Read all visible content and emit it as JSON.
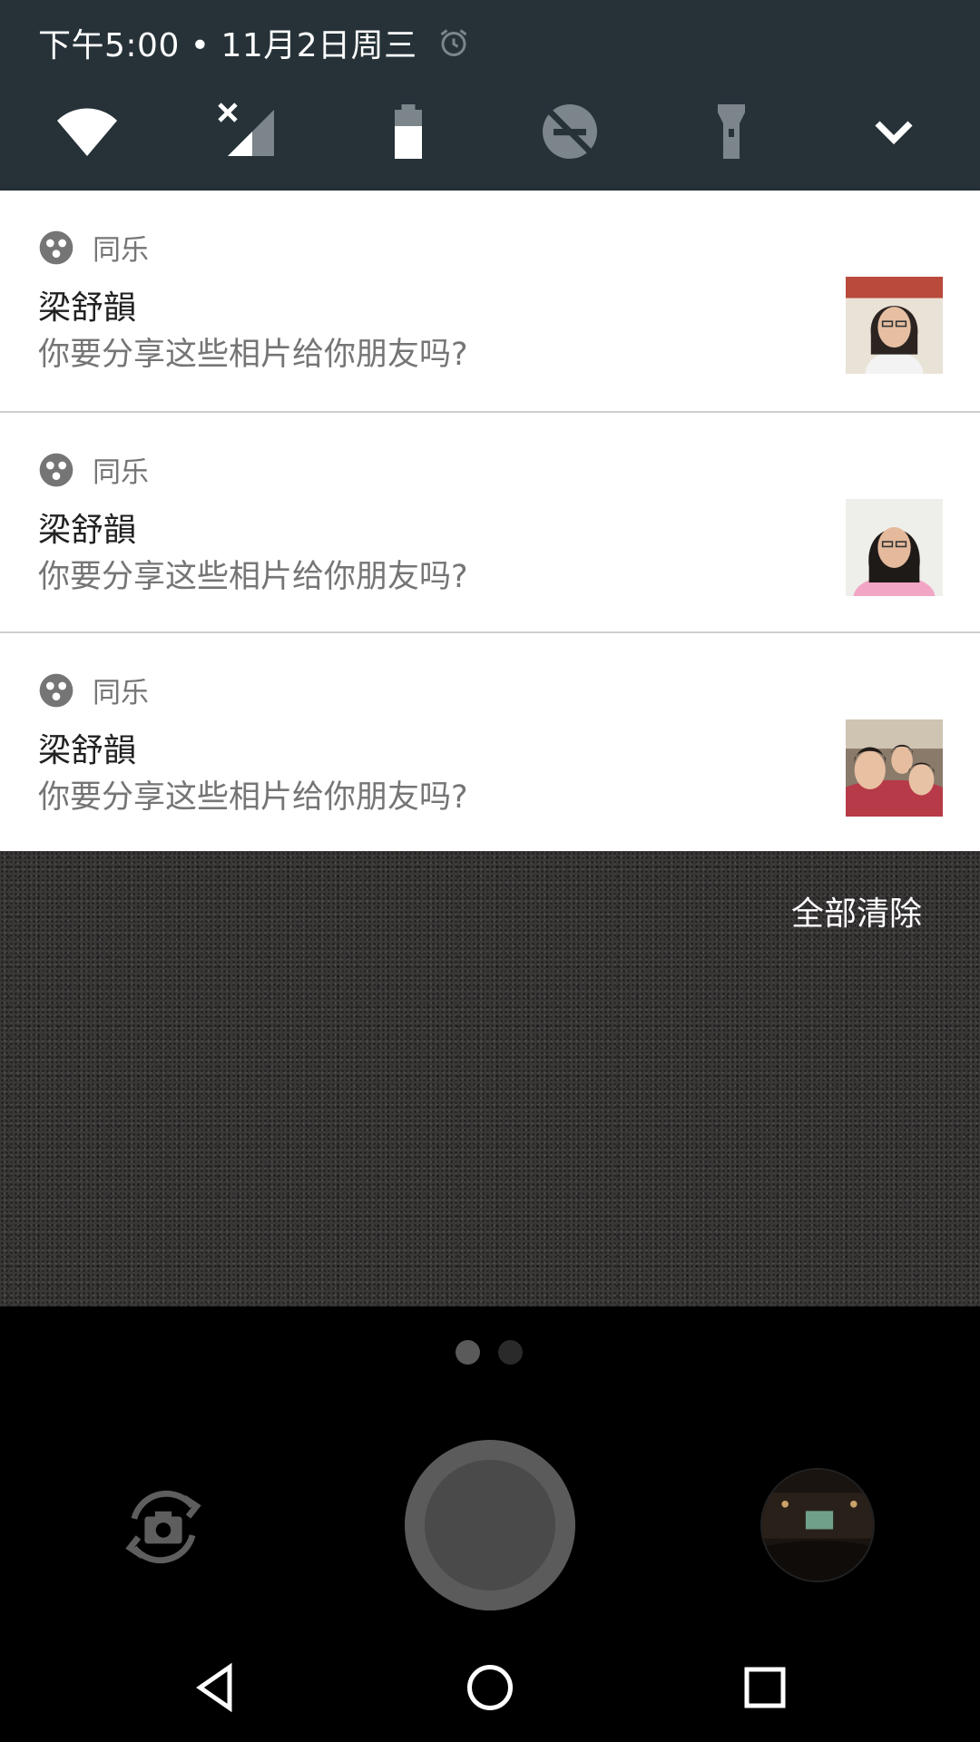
{
  "status_bar": {
    "time_date": "下午5:00 • 11月2日周三",
    "alarm_icon": "alarm-clock-icon"
  },
  "quick_settings": {
    "tiles": [
      "wifi-icon",
      "cellular-no-sim-icon",
      "battery-icon",
      "do-not-disturb-icon",
      "flashlight-icon",
      "expand-chevron-icon"
    ]
  },
  "notifications": [
    {
      "app": "同乐",
      "title": "梁舒韻",
      "text": "你要分享这些相片给你朋友吗?"
    },
    {
      "app": "同乐",
      "title": "梁舒韻",
      "text": "你要分享这些相片给你朋友吗?"
    },
    {
      "app": "同乐",
      "title": "梁舒韻",
      "text": "你要分享这些相片给你朋友吗?"
    }
  ],
  "clear_all_label": "全部清除",
  "camera": {
    "page_dots": 2,
    "active_page": 1
  },
  "navigation": [
    "back-icon",
    "home-icon",
    "recents-icon"
  ],
  "colors": {
    "header_bg": "#263238",
    "panel_bg": "#ffffff",
    "secondary_text": "#757575"
  }
}
